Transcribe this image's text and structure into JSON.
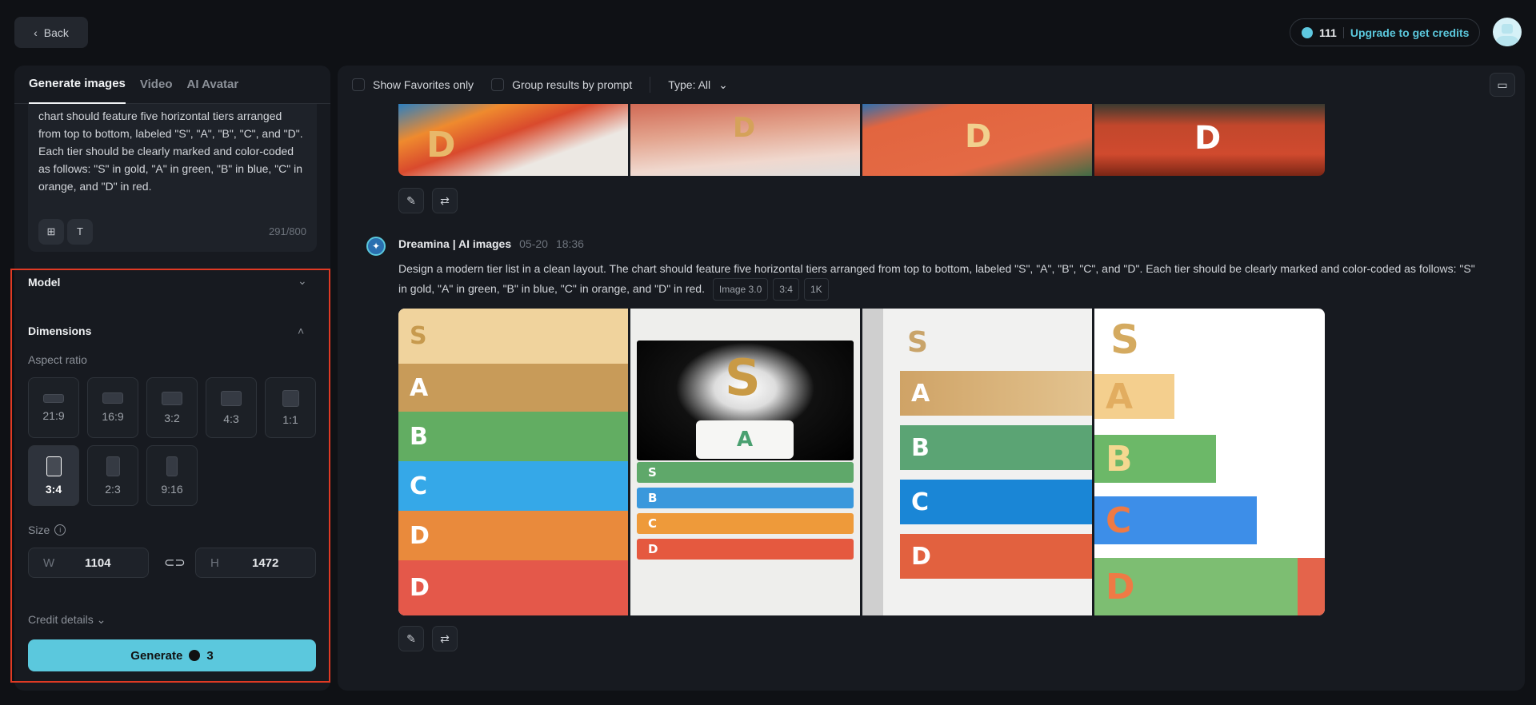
{
  "header": {
    "back_label": "Back",
    "credits": "111",
    "upgrade_label": "Upgrade to get credits"
  },
  "left": {
    "tabs": [
      {
        "label": "Generate images"
      },
      {
        "label": "Video"
      },
      {
        "label": "AI Avatar"
      }
    ],
    "prompt_text": "chart should feature five horizontal tiers arranged from top to bottom, labeled \"S\", \"A\", \"B\", \"C\", and \"D\". Each tier should be clearly marked and color-coded as follows: \"S\" in gold, \"A\" in green, \"B\" in blue, \"C\" in orange, and \"D\" in red.",
    "char_count": "291/800",
    "model_label": "Model",
    "dimensions_label": "Dimensions",
    "aspect_ratio_label": "Aspect ratio",
    "ratios": [
      "21:9",
      "16:9",
      "3:2",
      "4:3",
      "1:1",
      "3:4",
      "2:3",
      "9:16"
    ],
    "selected_ratio": "3:4",
    "size_label": "Size",
    "width_label": "W",
    "width_value": "1104",
    "height_label": "H",
    "height_value": "1472",
    "credit_details_label": "Credit details",
    "generate_label": "Generate",
    "generate_cost": "3"
  },
  "toolbar": {
    "favorites_label": "Show Favorites only",
    "group_label": "Group results by prompt",
    "type_label": "Type: All"
  },
  "feed": {
    "prev_letters": [
      "D",
      "D",
      "D",
      "D"
    ],
    "author": "Dreamina | AI images",
    "date": "05-20",
    "time": "18:36",
    "prompt": "Design a modern tier list in a clean layout. The chart should feature five horizontal tiers arranged from top to bottom, labeled \"S\", \"A\", \"B\", \"C\", and \"D\". Each tier should be clearly marked and color-coded as follows: \"S\" in gold, \"A\" in green, \"B\" in blue, \"C\" in orange, and \"D\" in red.",
    "tags": [
      "Image 3.0",
      "3:4",
      "1K"
    ],
    "tiers": {
      "s": "S",
      "a": "A",
      "b": "B",
      "c": "C",
      "d": "D"
    }
  },
  "colors": {
    "accent": "#5bc8dd",
    "highlight": "#e03a24"
  }
}
